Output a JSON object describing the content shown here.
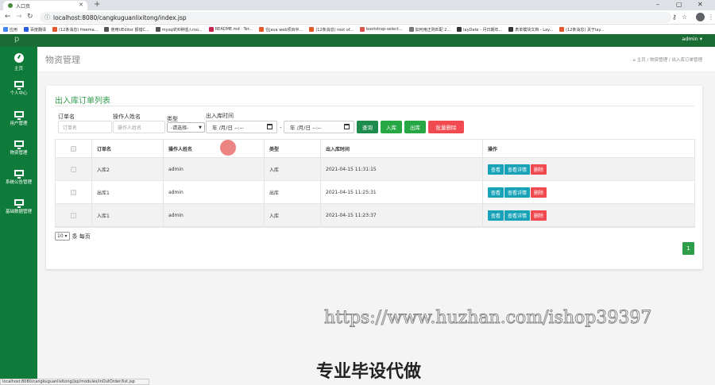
{
  "browser": {
    "tab_title": "入口页",
    "url": "localhost:8080/cangkuguanlixitong/index.jsp",
    "bookmarks": [
      {
        "label": "应用",
        "color": "#4285f4"
      },
      {
        "label": "百度翻译",
        "color": "#2b5fd9"
      },
      {
        "label": "(12条消息) freema...",
        "color": "#e25a2c"
      },
      {
        "label": "使用UEditor 报错C...",
        "color": "#555555"
      },
      {
        "label": "mysql的6种插入roo...",
        "color": "#555555"
      },
      {
        "label": "README.md · Ter...",
        "color": "#c7254e"
      },
      {
        "label": "在java web项目中...",
        "color": "#e25a2c"
      },
      {
        "label": "(12条消息) root of...",
        "color": "#e25a2c"
      },
      {
        "label": "bootstrap-select...",
        "color": "#d9534f"
      },
      {
        "label": "如何用正则匹配 2...",
        "color": "#777777"
      },
      {
        "label": "layDate - 月日期年...",
        "color": "#333333"
      },
      {
        "label": "表单模块文档 - Lay...",
        "color": "#333333"
      },
      {
        "label": "(12条消息) 关于lay...",
        "color": "#e25a2c"
      }
    ],
    "status_url": "localhost:8080/cangkuguanlixitong/jsp/modules/inOutOrder/list.jsp"
  },
  "topbar": {
    "logo": "p",
    "user": "admin ▾"
  },
  "sidebar": {
    "items": [
      {
        "label": "主页",
        "icon": "dashboard-icon"
      },
      {
        "label": "个人中心",
        "icon": "monitor-icon"
      },
      {
        "label": "用户管理",
        "icon": "monitor-icon"
      },
      {
        "label": "物资管理",
        "icon": "monitor-icon"
      },
      {
        "label": "系统公告管理",
        "icon": "monitor-icon"
      },
      {
        "label": "基础数据管理",
        "icon": "monitor-icon"
      }
    ]
  },
  "header": {
    "title": "物资管理",
    "breadcrumb": [
      "主页",
      "物资管理",
      "出入库订单管理"
    ]
  },
  "card": {
    "title": "出入库订单列表",
    "filters": {
      "order_label": "订单名",
      "order_placeholder": "订单名",
      "operator_label": "操作人姓名",
      "operator_placeholder": "操作人姓名",
      "type_label": "类型",
      "type_value": "-请选择-",
      "time_label": "出入库时间",
      "date_start": "年 /月/日 --:--",
      "date_sep": "-",
      "date_end": "年 /月/日 --:--"
    },
    "buttons": {
      "query": "查询",
      "inbound": "入库",
      "outbound": "出库",
      "batch_delete": "批量删除"
    },
    "colors": {
      "query": "#1d8a4e",
      "inbound": "#28a745",
      "outbound": "#28a745",
      "batch_delete": "#f0494f",
      "view": "#17a2b8",
      "detail": "#17a2b8",
      "delete": "#f0494f",
      "title": "#2e9d4a"
    },
    "table": {
      "headers": [
        "订单名",
        "操作人姓名",
        "类型",
        "出入库时间",
        "操作"
      ],
      "rows": [
        {
          "name": "入库2",
          "operator": "admin",
          "type": "入库",
          "time": "2021-04-15 11:31:15"
        },
        {
          "name": "出库1",
          "operator": "admin",
          "type": "出库",
          "time": "2021-04-15 11:25:31"
        },
        {
          "name": "入库1",
          "operator": "admin",
          "type": "入库",
          "time": "2021-04-15 11:23:37"
        }
      ],
      "actions": {
        "view": "查看",
        "detail": "查看详情",
        "delete": "删除"
      }
    },
    "pager": {
      "page_size": "10",
      "per_page_label": "条 每页",
      "current_page": "1"
    }
  },
  "overlay": {
    "watermark": "https://www.huzhan.com/ishop39397",
    "caption": "专业毕设代做"
  }
}
